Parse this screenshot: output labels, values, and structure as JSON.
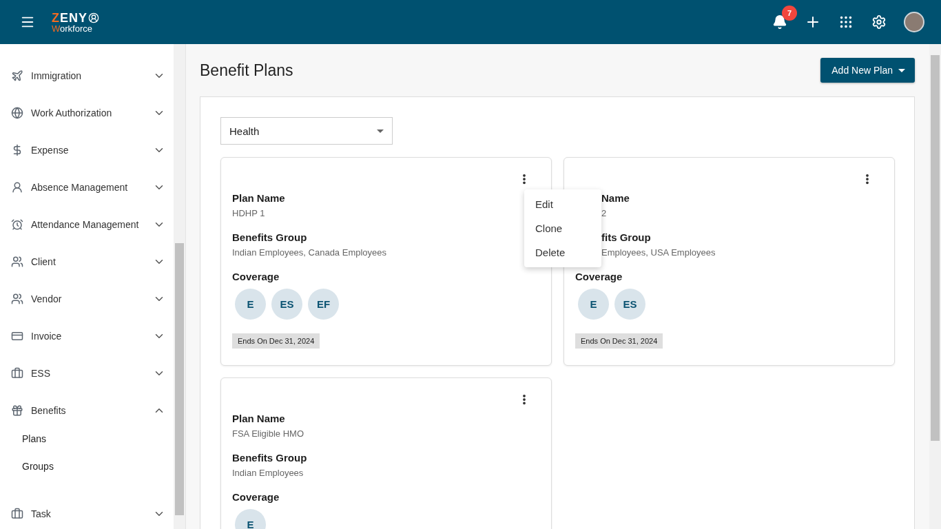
{
  "header": {
    "logo": {
      "top": "ZENY",
      "bottom": "Workforce"
    },
    "notifications": {
      "count": "7"
    }
  },
  "sidebar": {
    "items": [
      {
        "label": "Immigration",
        "expanded": false
      },
      {
        "label": "Work Authorization",
        "expanded": false
      },
      {
        "label": "Expense",
        "expanded": false
      },
      {
        "label": "Absence Management",
        "expanded": false
      },
      {
        "label": "Attendance Management",
        "expanded": false
      },
      {
        "label": "Client",
        "expanded": false
      },
      {
        "label": "Vendor",
        "expanded": false
      },
      {
        "label": "Invoice",
        "expanded": false
      },
      {
        "label": "ESS",
        "expanded": false
      },
      {
        "label": "Benefits",
        "expanded": true,
        "children": [
          {
            "label": "Plans"
          },
          {
            "label": "Groups"
          }
        ]
      },
      {
        "label": "Task",
        "expanded": false
      }
    ]
  },
  "page": {
    "title": "Benefit Plans",
    "add_button": "Add New Plan"
  },
  "filter": {
    "value": "Health"
  },
  "cards": [
    {
      "plan_label": "Plan Name",
      "plan": "HDHP 1",
      "group_label": "Benefits Group",
      "group": "Indian Employees, Canada Employees",
      "coverage_label": "Coverage",
      "coverage": [
        "E",
        "ES",
        "EF"
      ],
      "ends": "Ends On Dec 31, 2024",
      "menu_open": true,
      "partly_covered": false
    },
    {
      "plan_label": "Name",
      "plan": "2",
      "group_label": "fits Group",
      "group": "Employees, USA Employees",
      "coverage_label": "Coverage",
      "coverage": [
        "E",
        "ES"
      ],
      "ends": "Ends On Dec 31, 2024",
      "menu_open": false,
      "partly_covered": true
    },
    {
      "plan_label": "Plan Name",
      "plan": "FSA Eligible HMO",
      "group_label": "Benefits Group",
      "group": "Indian Employees",
      "coverage_label": "Coverage",
      "coverage": [
        "E"
      ],
      "menu_open": false,
      "partly_covered": false
    }
  ],
  "card_menu": [
    "Edit",
    "Clone",
    "Delete"
  ]
}
